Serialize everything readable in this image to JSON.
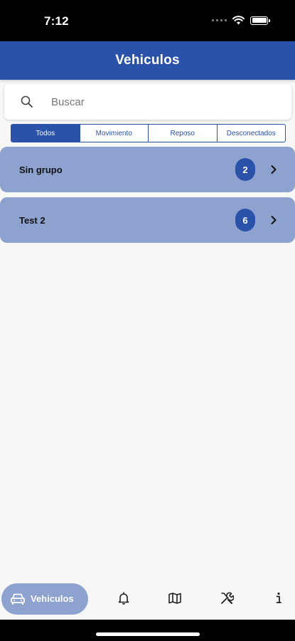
{
  "status_bar": {
    "time": "7:12"
  },
  "header": {
    "title": "Vehiculos"
  },
  "search": {
    "placeholder": "Buscar",
    "value": ""
  },
  "filters": [
    {
      "label": "Todos",
      "active": true
    },
    {
      "label": "Movimiento",
      "active": false
    },
    {
      "label": "Reposo",
      "active": false
    },
    {
      "label": "Desconectados",
      "active": false
    }
  ],
  "groups": [
    {
      "label": "Sin grupo",
      "count": "2"
    },
    {
      "label": "Test 2",
      "count": "6"
    }
  ],
  "bottom_nav": {
    "vehicles_label": "Vehiculos",
    "items": [
      "car-icon",
      "bell-icon",
      "map-icon",
      "tools-icon",
      "info-icon"
    ]
  },
  "colors": {
    "primary": "#2a52a8",
    "group_background": "#8ea2d0",
    "page_background": "#f7f7f8"
  }
}
